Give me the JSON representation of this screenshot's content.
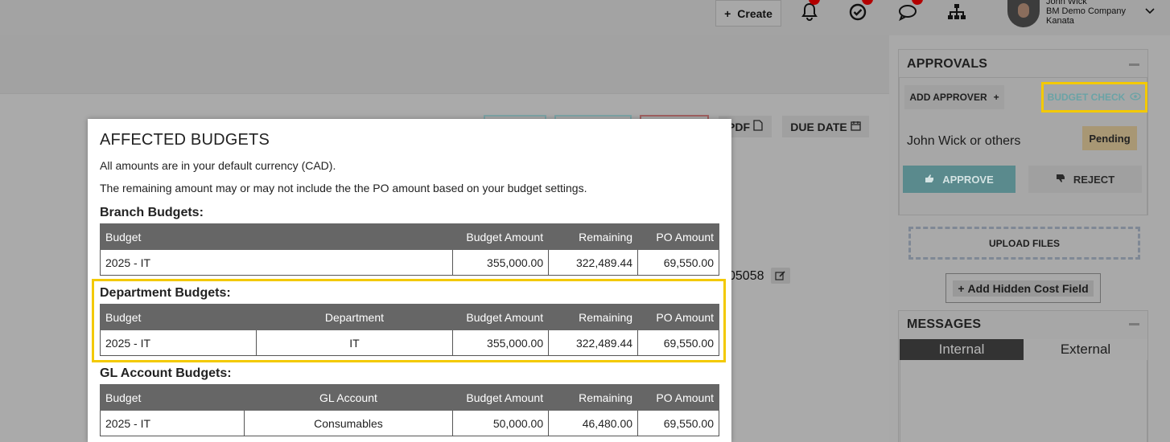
{
  "topbar": {
    "create_label": "Create",
    "create_icon": "plus-icon",
    "user": {
      "name": "John Wick",
      "company": "BM Demo Company",
      "location": "Kanata"
    }
  },
  "background": {
    "pdf_label": "PDF",
    "due_date_label": "DUE DATE",
    "po_number_fragment": "05058"
  },
  "approvals": {
    "title": "APPROVALS",
    "add_approver_label": "ADD APPROVER",
    "budget_check_label": "BUDGET CHECK",
    "approver_name": "John Wick or others",
    "status": "Pending",
    "approve_label": "APPROVE",
    "reject_label": "REJECT",
    "upload_label": "UPLOAD FILES",
    "hidden_cost_label": "Add Hidden Cost Field"
  },
  "messages": {
    "title": "MESSAGES",
    "tabs": [
      "Internal",
      "External"
    ]
  },
  "modal": {
    "title": "AFFECTED BUDGETS",
    "line1": "All amounts are in your default currency (CAD).",
    "line2": "The remaining amount may or may not include the the PO amount based on your budget settings.",
    "branch": {
      "title": "Branch Budgets:",
      "headers": [
        "Budget",
        "Budget Amount",
        "Remaining",
        "PO Amount"
      ],
      "row": [
        "2025 - IT",
        "355,000.00",
        "322,489.44",
        "69,550.00"
      ]
    },
    "department": {
      "title": "Department Budgets:",
      "headers": [
        "Budget",
        "Department",
        "Budget Amount",
        "Remaining",
        "PO Amount"
      ],
      "row": [
        "2025 - IT",
        "IT",
        "355,000.00",
        "322,489.44",
        "69,550.00"
      ]
    },
    "gl": {
      "title": "GL Account Budgets:",
      "headers": [
        "Budget",
        "GL Account",
        "Budget Amount",
        "Remaining",
        "PO Amount"
      ],
      "row": [
        "2025 - IT",
        "Consumables",
        "50,000.00",
        "46,480.00",
        "69,550.00"
      ]
    }
  },
  "colors": {
    "highlight": "#f3c900",
    "table_header": "#666666",
    "approve_bg": "#5a8a8d"
  }
}
